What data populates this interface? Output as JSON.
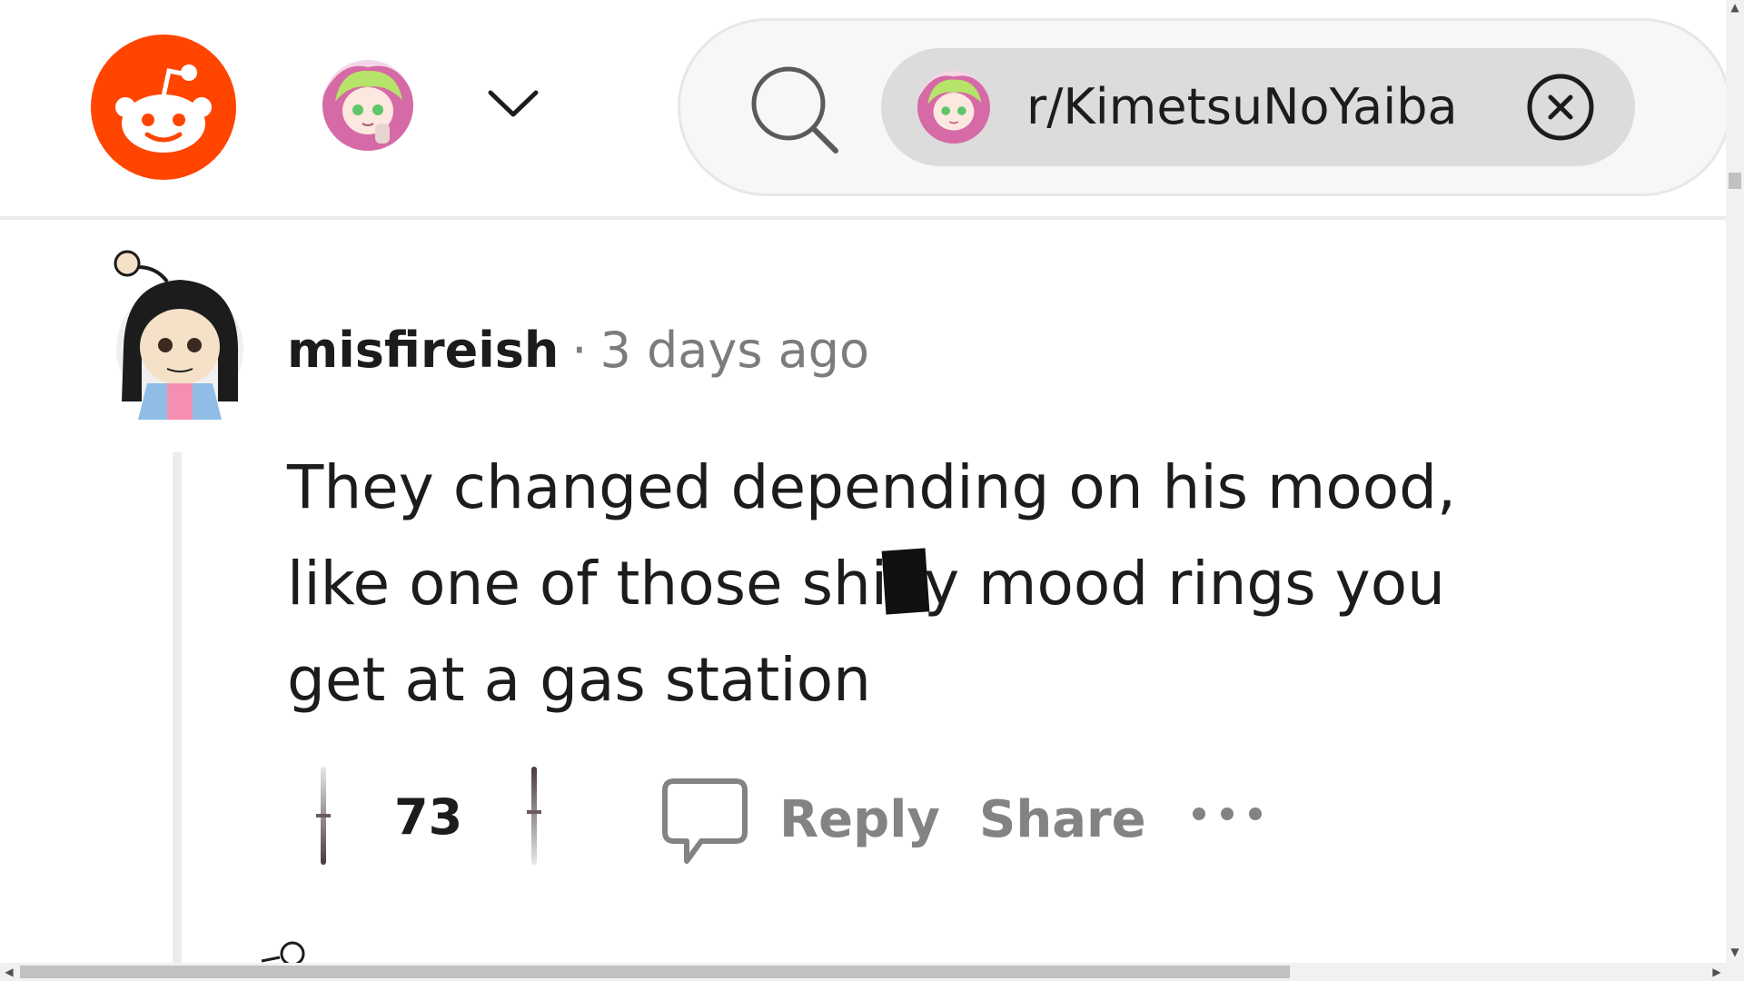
{
  "header": {
    "logo_icon": "reddit-snoo-icon",
    "brand_color": "#ff4500",
    "user_avatar_icon": "user-avatar",
    "menu_icon": "chevron-down-icon",
    "search": {
      "icon": "search-icon",
      "chip": {
        "label": "r/KimetsuNoYaiba",
        "icon": "subreddit-avatar",
        "close_icon": "close-circle-icon"
      }
    }
  },
  "comment": {
    "author": "misfireish",
    "separator": "·",
    "timestamp": "3 days ago",
    "body_part1": "They changed depending on his mood, like one of those shi",
    "body_part2": "y mood rings you get at a gas station",
    "censored": true,
    "actions": {
      "score": "73",
      "upvote_icon": "upvote-icon",
      "downvote_icon": "downvote-icon",
      "reply_icon": "speech-bubble-icon",
      "reply_label": "Reply",
      "share_label": "Share",
      "more_icon": "more-horizontal-icon"
    }
  },
  "colors": {
    "text_primary": "#1c1c1c",
    "text_secondary": "#7c7c7c",
    "action_gray": "#818384",
    "thread_line": "#ececec"
  }
}
